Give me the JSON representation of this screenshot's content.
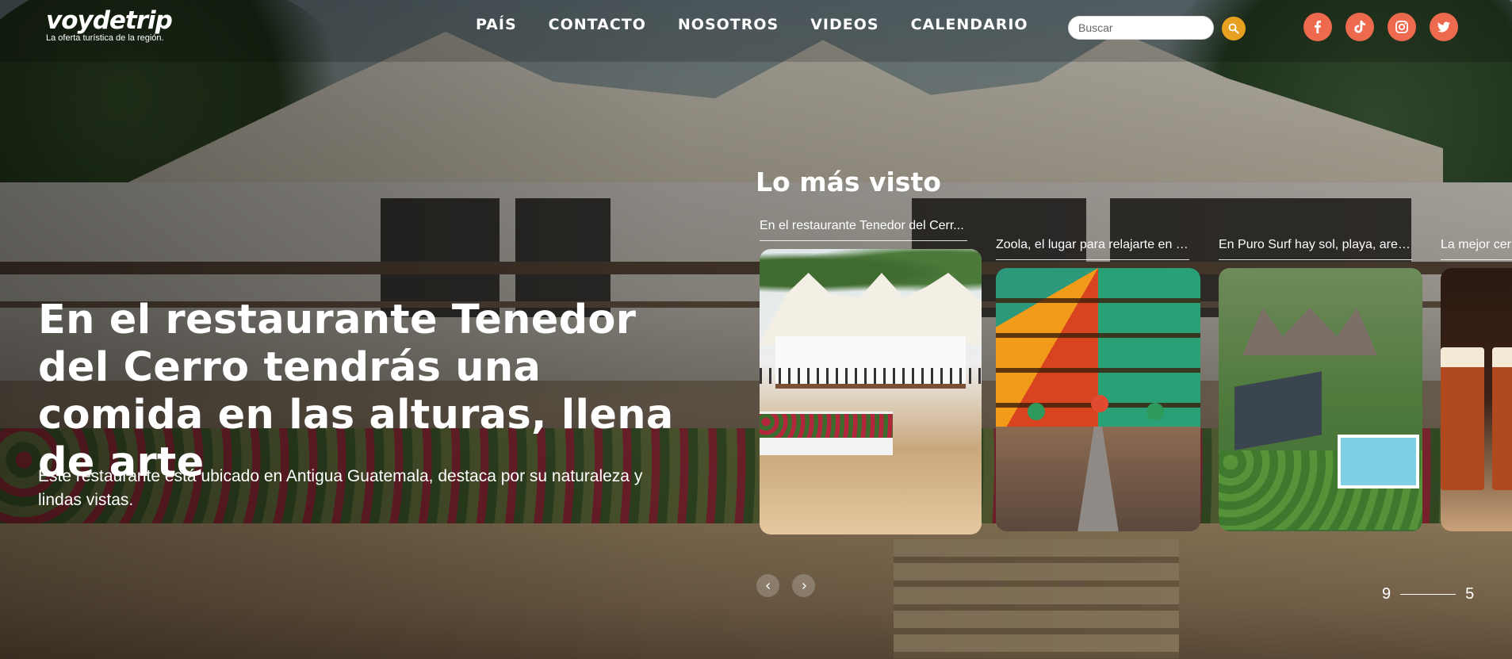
{
  "header": {
    "logo": {
      "name": "voydetrip",
      "tagline": "La oferta turística de la región."
    },
    "nav": [
      "PAÍS",
      "CONTACTO",
      "NOSOTROS",
      "VIDEOS",
      "CALENDARIO"
    ],
    "search": {
      "placeholder": "Buscar",
      "value": ""
    },
    "search_button_icon": "search-icon",
    "socials": [
      "facebook-icon",
      "tiktok-icon",
      "instagram-icon",
      "twitter-icon"
    ],
    "colors": {
      "search_button": "#e7a01f",
      "social": "#ee6a4e"
    }
  },
  "hero": {
    "title": "En el restaurante Tenedor del Cerro tendrás una comida en las alturas, llena de arte",
    "description": "Este restaurante está ubicado en Antigua Guatemala, destaca por su naturaleza y lindas vistas."
  },
  "most_viewed": {
    "title": "Lo más visto",
    "cards": [
      {
        "caption": "En el restaurante Tenedor del Cerr..."
      },
      {
        "caption": "Zoola, el lugar para relajarte en el ..."
      },
      {
        "caption": "En Puro Surf hay sol, playa, arena ..."
      },
      {
        "caption": "La mejor cer"
      }
    ]
  },
  "slider": {
    "prev_icon": "chevron-left-icon",
    "next_icon": "chevron-right-icon",
    "current": "9",
    "total": "5"
  }
}
